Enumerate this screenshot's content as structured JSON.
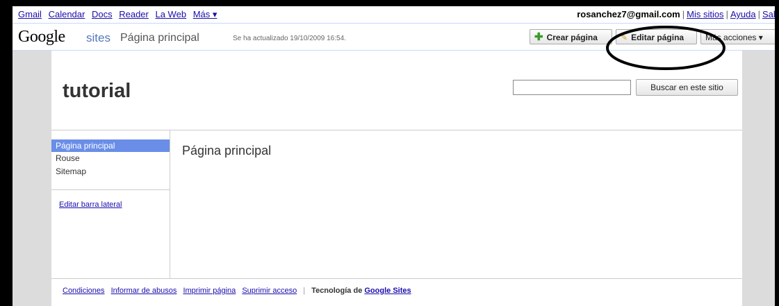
{
  "topnav": {
    "links": [
      "Gmail",
      "Calendar",
      "Docs",
      "Reader",
      "La Web",
      "Más ▾"
    ],
    "email": "rosanchez7@gmail.com",
    "user_links": [
      "Mis sitios",
      "Ayuda",
      "Salir"
    ]
  },
  "header": {
    "logo_google": "Google",
    "logo_sites": "sites",
    "page_title": "Página principal",
    "updated": "Se ha actualizado 19/10/2009 16:54.",
    "create_label": "Crear página",
    "edit_label": "Editar página",
    "more_label": "Más acciones ▾"
  },
  "site": {
    "title": "tutorial",
    "search_placeholder": "",
    "search_button": "Buscar en este sitio"
  },
  "sidebar": {
    "items": [
      {
        "label": "Página principal",
        "active": true
      },
      {
        "label": "Rouse",
        "active": false
      },
      {
        "label": "Sitemap",
        "active": false
      }
    ],
    "edit_link": "Editar barra lateral"
  },
  "content": {
    "title": "Página principal"
  },
  "footer": {
    "links": [
      "Condiciones",
      "Informar de abusos",
      "Imprimir página",
      "Suprimir acceso"
    ],
    "tech_prefix": "Tecnología de",
    "tech_link": "Google Sites"
  },
  "colors": {
    "link": "#1a0dab",
    "sidebar_active": "#6a8ee8",
    "gutter": "#dcdcdc",
    "header_border": "#c3d9ff"
  }
}
